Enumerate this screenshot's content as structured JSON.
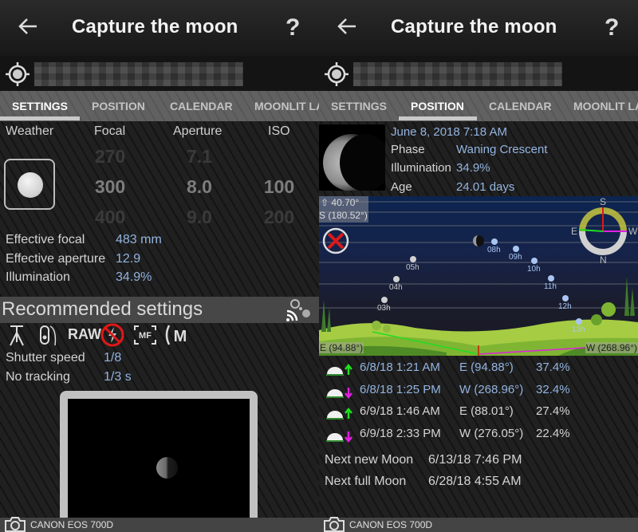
{
  "app": {
    "title": "Capture the moon",
    "back_icon": "arrow-left-icon",
    "help_icon": "question-mark-icon",
    "gps_icon": "crosshair-gps-icon"
  },
  "tabs": [
    {
      "label": "SETTINGS"
    },
    {
      "label": "POSITION"
    },
    {
      "label": "CALENDAR"
    },
    {
      "label": "MOONLIT LA"
    }
  ],
  "settings": {
    "headers": {
      "weather": "Weather",
      "focal": "Focal",
      "aperture": "Aperture",
      "iso": "ISO"
    },
    "focal": {
      "prev": "270",
      "current": "300",
      "next": "400"
    },
    "aperture": {
      "prev": "7.1",
      "current": "8.0",
      "next": "9.0"
    },
    "iso": {
      "prev": "",
      "current": "100",
      "next": "200"
    },
    "effective_focal_label": "Effective focal",
    "effective_focal_value": "483 mm",
    "effective_aperture_label": "Effective aperture",
    "effective_aperture_value": "12.9",
    "illumination_label": "Illumination",
    "illumination_value": "34.9%",
    "recommended_title": "Recommended settings",
    "icons": [
      "tripod-icon",
      "remote-shutter-icon",
      "raw-format-icon",
      "no-flash-icon",
      "manual-focus-icon",
      "manual-mode-icon"
    ],
    "raw_label": "RAW",
    "mf_label": "MF",
    "m_label": "M",
    "shutter_label": "Shutter speed",
    "shutter_value": "1/8",
    "no_tracking_label": "No tracking",
    "no_tracking_value": "1/3 s"
  },
  "position": {
    "datetime": "June 8, 2018 7:18 AM",
    "phase_label": "Phase",
    "phase_value": "Waning Crescent",
    "illumination_label": "Illumination",
    "illumination_value": "34.9%",
    "age_label": "Age",
    "age_value": "24.01 days",
    "altitude_readout": "⇧ 40.70°",
    "azimuth_readout": "S (180.52°)",
    "rise_azimuth_readout": "E (94.88°)",
    "set_azimuth_readout": "W (268.96°)",
    "compass": {
      "n": "N",
      "s": "S",
      "e": "E",
      "w": "W"
    },
    "hour_marks": [
      {
        "label": "03h",
        "lit": false
      },
      {
        "label": "04h",
        "lit": false
      },
      {
        "label": "05h",
        "lit": false
      },
      {
        "label": "08h",
        "lit": true
      },
      {
        "label": "09h",
        "lit": true
      },
      {
        "label": "10h",
        "lit": true
      },
      {
        "label": "11h",
        "lit": true
      },
      {
        "label": "12h",
        "lit": true
      },
      {
        "label": "13h",
        "lit": true
      }
    ],
    "events": [
      {
        "type": "rise",
        "datetime": "6/8/18 1:21 AM",
        "azimuth": "E (94.88°)",
        "illumination": "37.4%",
        "highlight": true
      },
      {
        "type": "set",
        "datetime": "6/8/18 1:25 PM",
        "azimuth": "W (268.96°)",
        "illumination": "32.4%",
        "highlight": true
      },
      {
        "type": "rise",
        "datetime": "6/9/18 1:46 AM",
        "azimuth": "E (88.01°)",
        "illumination": "27.4%",
        "highlight": false
      },
      {
        "type": "set",
        "datetime": "6/9/18 2:33 PM",
        "azimuth": "W (276.05°)",
        "illumination": "22.4%",
        "highlight": false
      }
    ],
    "next_new_label": "Next new Moon",
    "next_new_value": "6/13/18 7:46 PM",
    "next_full_label": "Next full Moon",
    "next_full_value": "6/28/18 4:55 AM"
  },
  "footer": {
    "camera": "CANON EOS 700D",
    "camera_icon": "camera-icon"
  },
  "colors": {
    "accent_value": "#93b4e0",
    "rise_arrow": "#22dd22",
    "set_arrow": "#e020e0"
  }
}
